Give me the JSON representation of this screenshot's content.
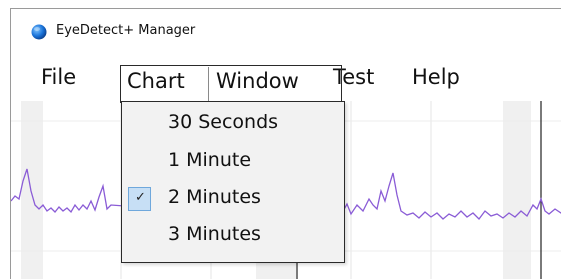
{
  "window": {
    "title": "EyeDetect+ Manager",
    "app_icon": "globe-app-icon"
  },
  "menubar": {
    "items": [
      {
        "label": "File"
      },
      {
        "label": "Chart"
      },
      {
        "label": "Window"
      },
      {
        "label": "Test"
      },
      {
        "label": "Help"
      }
    ],
    "open_menu": "Chart"
  },
  "chart_menu": {
    "items": [
      {
        "label": "30 Seconds",
        "checked": false
      },
      {
        "label": "1 Minute",
        "checked": false
      },
      {
        "label": "2 Minutes",
        "checked": true
      },
      {
        "label": "3 Minutes",
        "checked": false
      }
    ],
    "check_icon": "checkmark-icon"
  },
  "colors": {
    "signal_line": "#8a5cd6",
    "selection_bg": "#c7dff5",
    "selection_border": "#6fa8dc",
    "grid_band": "#f0f0f0",
    "menu_bg": "#f2f2f2"
  }
}
